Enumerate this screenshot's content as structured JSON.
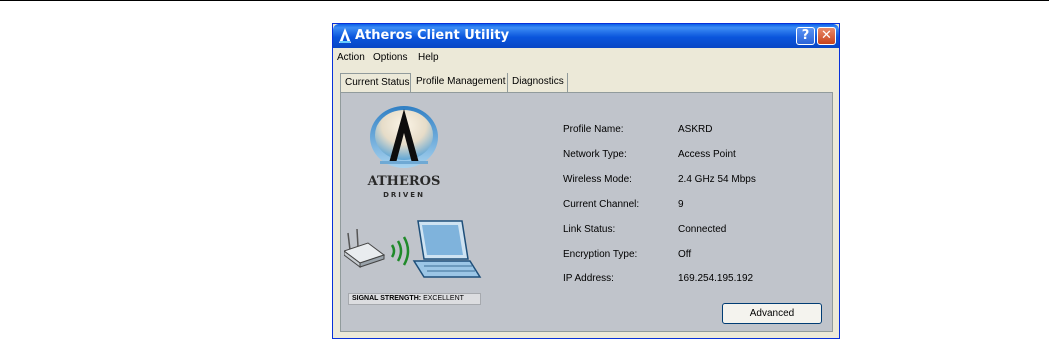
{
  "window": {
    "title": "Atheros Client Utility",
    "help_glyph": "?",
    "close_glyph": "✕"
  },
  "menu": [
    "Action",
    "Options",
    "Help"
  ],
  "tabs": [
    {
      "label": "Current Status",
      "active": true
    },
    {
      "label": "Profile Management",
      "active": false
    },
    {
      "label": "Diagnostics",
      "active": false
    }
  ],
  "logo": {
    "line1": "ATHEROS",
    "line2": "DRIVEN"
  },
  "signal": {
    "label": "SIGNAL STRENGTH:",
    "value": "EXCELLENT"
  },
  "status_fields": [
    {
      "label": "Profile Name:",
      "value": "ASKRD"
    },
    {
      "label": "Network Type:",
      "value": "Access Point"
    },
    {
      "label": "Wireless Mode:",
      "value": "2.4 GHz 54 Mbps"
    },
    {
      "label": "Current Channel:",
      "value": "9"
    },
    {
      "label": "Link Status:",
      "value": "Connected"
    },
    {
      "label": "Encryption Type:",
      "value": "Off"
    },
    {
      "label": "IP Address:",
      "value": "169.254.195.192"
    }
  ],
  "advanced_button": "Advanced",
  "colors": {
    "titlebar": "#0a55dc",
    "panel": "#c0c4cb",
    "window": "#ece9d8",
    "signal_waves": "#1f8a2a"
  }
}
